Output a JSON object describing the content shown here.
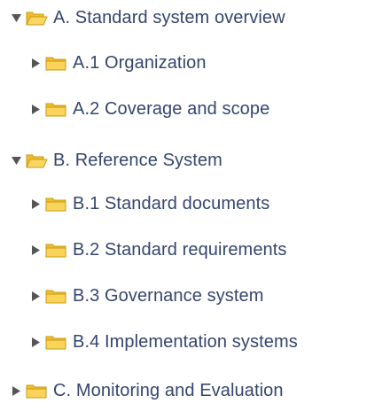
{
  "tree": {
    "nodes": [
      {
        "label": "A. Standard system overview",
        "expanded": true,
        "level": 0,
        "folder_icon": "folder-open-icon",
        "toggle_icon": "triangle-down-icon"
      },
      {
        "label": "A.1 Organization",
        "expanded": false,
        "level": 1,
        "folder_icon": "folder-closed-icon",
        "toggle_icon": "triangle-right-icon"
      },
      {
        "label": "A.2 Coverage and scope",
        "expanded": false,
        "level": 1,
        "folder_icon": "folder-closed-icon",
        "toggle_icon": "triangle-right-icon"
      },
      {
        "label": "B. Reference System",
        "expanded": true,
        "level": 0,
        "folder_icon": "folder-open-icon",
        "toggle_icon": "triangle-down-icon"
      },
      {
        "label": "B.1 Standard documents",
        "expanded": false,
        "level": 1,
        "folder_icon": "folder-closed-icon",
        "toggle_icon": "triangle-right-icon"
      },
      {
        "label": "B.2 Standard requirements",
        "expanded": false,
        "level": 1,
        "folder_icon": "folder-closed-icon",
        "toggle_icon": "triangle-right-icon"
      },
      {
        "label": "B.3 Governance system",
        "expanded": false,
        "level": 1,
        "folder_icon": "folder-closed-icon",
        "toggle_icon": "triangle-right-icon"
      },
      {
        "label": "B.4 Implementation systems",
        "expanded": false,
        "level": 1,
        "folder_icon": "folder-closed-icon",
        "toggle_icon": "triangle-right-icon"
      },
      {
        "label": "C. Monitoring and Evaluation",
        "expanded": false,
        "level": 0,
        "folder_icon": "folder-closed-icon",
        "toggle_icon": "triangle-right-icon"
      }
    ]
  },
  "colors": {
    "label_text": "#35456e",
    "toggle": "#555555",
    "folder_fill": "#f7c948",
    "folder_outline": "#c99a12"
  }
}
